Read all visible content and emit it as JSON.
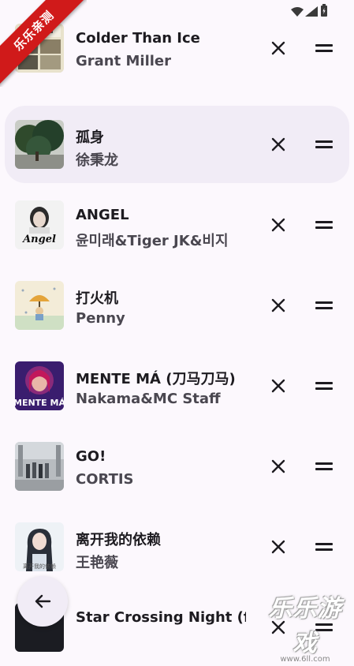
{
  "watermark": {
    "ribbon": "乐乐亲测",
    "brand": "乐乐游戏",
    "url": "www.6ll.com"
  },
  "queue": [
    {
      "title": "Colder Than Ice",
      "artist": "Grant Miller",
      "cover": "cover-grant-miller"
    },
    {
      "title": "孤身",
      "artist": "徐秉龙",
      "cover": "cover-trees",
      "selected": true
    },
    {
      "title": "ANGEL",
      "artist": "윤미래&Tiger JK&비지",
      "cover": "cover-angel"
    },
    {
      "title": "打火机",
      "artist": "Penny",
      "cover": "cover-umbrella"
    },
    {
      "title": "MENTE MÁ (刀马刀马)",
      "artist": "Nakama&MC Staff",
      "cover": "cover-mente-ma"
    },
    {
      "title": "GO!",
      "artist": "CORTIS",
      "cover": "cover-go"
    },
    {
      "title": "离开我的依赖",
      "artist": "王艳薇",
      "cover": "cover-girl"
    },
    {
      "title": "Star Crossing Night (f",
      "artist": "",
      "cover": "cover-dark"
    }
  ],
  "icons": {
    "back": "arrow-back-icon",
    "remove": "close-icon",
    "drag": "drag-handle-icon"
  }
}
